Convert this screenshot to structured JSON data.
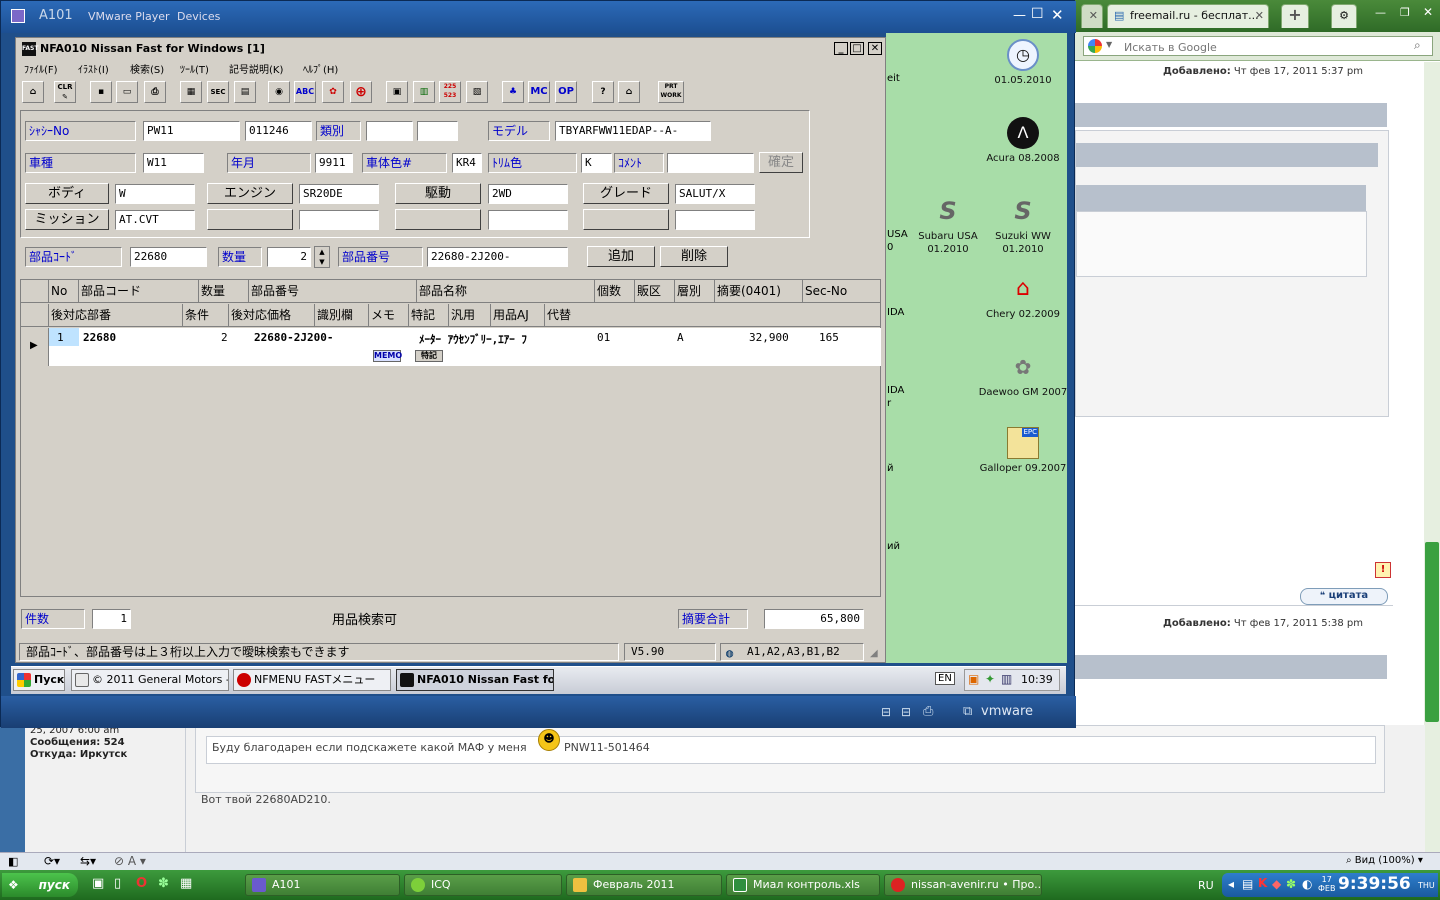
{
  "vmware": {
    "title": "A101",
    "menu": [
      "VMware Player",
      "Devices"
    ],
    "brand": "vmware"
  },
  "browser": {
    "tabs": [
      {
        "label": "freemail.ru - бесплат..."
      }
    ],
    "search_placeholder": "Искать в Google",
    "posts": [
      {
        "posted_label": "Добавлено:",
        "posted_date": "Чт фев 17, 2011 5:37 pm"
      },
      {
        "posted_label": "Добавлено:",
        "posted_date": "Чт фев 17, 2011 5:38 pm"
      }
    ],
    "quote_label": "цитата",
    "author_info": {
      "registered": "25, 2007 6:00 am",
      "messages": "Сообщения: 524",
      "location": "Откуда: Иркутск"
    },
    "post_text_1": "Буду благодарен если подскажете какой МАФ у меня",
    "post_vin": "PNW11-501464",
    "post_text_2": "Вот твой 22680AD210.",
    "zoom": "Вид (100%)"
  },
  "host_taskbar": {
    "start": "пуск",
    "tasks": [
      {
        "label": "A101"
      },
      {
        "label": "ICQ"
      },
      {
        "label": "Февраль 2011"
      },
      {
        "label": "Миал контроль.xls"
      },
      {
        "label": "nissan-avenir.ru • Про..."
      }
    ],
    "lang": "RU",
    "date_day": "17",
    "date_month": "ФЕВ",
    "time": "9:39:56",
    "weekday": "THU"
  },
  "guest_desktop": {
    "icons": [
      {
        "label": "01.05.2010"
      },
      {
        "label": "Acura 08.2008"
      },
      {
        "label": "Subaru USA 01.2010"
      },
      {
        "label": "Suzuki WW 01.2010"
      },
      {
        "label": "Chery 02.2009"
      },
      {
        "label": "Daewoo GM 2007"
      },
      {
        "label": "Galloper 09.2007"
      }
    ],
    "partial": [
      "eit",
      "USA",
      "0",
      "IDA",
      "IDA",
      "r",
      "й",
      "ий"
    ]
  },
  "guest_taskbar": {
    "start": "Пуск",
    "tasks": [
      {
        "label": "© 2011 General Motors -..."
      },
      {
        "label": "NFMENU FASTメニュー"
      },
      {
        "label": "NFA010 Nissan Fast fo..."
      }
    ],
    "lang": "EN",
    "time": "10:39"
  },
  "nfa": {
    "app_icon": "FAST",
    "title": "NFA010 Nissan Fast for Windows [1]",
    "menu": [
      "ﾌｧｲﾙ(F)",
      "ｲﾗｽﾄ(I)",
      "検索(S)",
      "ﾂｰﾙ(T)",
      "記号説明(K)",
      "ﾍﾙﾌﾟ(H)"
    ],
    "toolbar": [
      "CLR",
      "SEC",
      "ABC",
      "225 523",
      "MC",
      "OP",
      "PRT WORK"
    ],
    "form": {
      "chassis_label": "ｼｬｼｰNo",
      "chassis_value": "PW11",
      "chassis_serial": "011246",
      "class_label": "類別",
      "class_value1": "",
      "class_value2": "",
      "model_label": "モデル",
      "model_value": "TBYARFWW11EDAP--A-",
      "type_label": "車種",
      "type_value": "W11",
      "year_label": "年月",
      "year_value": "9911",
      "color_label": "車体色#",
      "color_value": "KR4",
      "trim_label": "ﾄﾘﾑ色",
      "trim_value": "K",
      "comment_label": "ｺﾒﾝﾄ",
      "comment_value": "",
      "confirm_label": "確定",
      "body_label": "ボディ",
      "body_value": "W",
      "engine_label": "エンジン",
      "engine_value": "SR20DE",
      "drive_label": "駆動",
      "drive_value": "2WD",
      "grade_label": "グレード",
      "grade_value": "SALUT/X",
      "mission_label": "ミッション",
      "mission_value": "AT.CVT",
      "part_code_label": "部品ｺｰﾄﾞ",
      "part_code_value": "22680",
      "qty_label": "数量",
      "qty_value": "2",
      "part_no_label": "部品番号",
      "part_no_value": "22680-2J200-",
      "add_label": "追加",
      "delete_label": "削除"
    },
    "grid": {
      "headers_row1": [
        "No",
        "部品コード",
        "数量",
        "部品番号",
        "部品名称",
        "個数",
        "販区",
        "層別",
        "摘要(0401)",
        "Sec-No"
      ],
      "headers_row2": [
        "後対応部番",
        "条件",
        "後対応価格",
        "識別欄",
        "メモ",
        "特記",
        "汎用",
        "用品AJ",
        "代替"
      ],
      "rows": [
        {
          "no": "1",
          "part_code": "22680",
          "qty": "2",
          "part_no": "22680-2J200-",
          "name": "ﾒｰﾀｰ ｱｳｾﾝﾌﾞﾘｰ,ｴｱｰ ﾌ",
          "count": "01",
          "layer": "A",
          "summary": "32,900",
          "sec": "165",
          "memo_tag": "MEMO",
          "note_tag": "特記"
        }
      ]
    },
    "footer": {
      "count_label": "件数",
      "count_value": "1",
      "center_text": "用品検索可",
      "total_label": "摘要合計",
      "total_value": "65,800"
    },
    "status": {
      "message": "部品ｺｰﾄﾞ、部品番号は上３桁以上入力で曖昧検索もできます",
      "version": "V5.90",
      "areas": "A1,A2,A3,B1,B2"
    }
  },
  "colors": {
    "desktop_green": "#a8dda8",
    "vmware_blue": "#1f4f8a",
    "label_blue": "#0000cc"
  }
}
